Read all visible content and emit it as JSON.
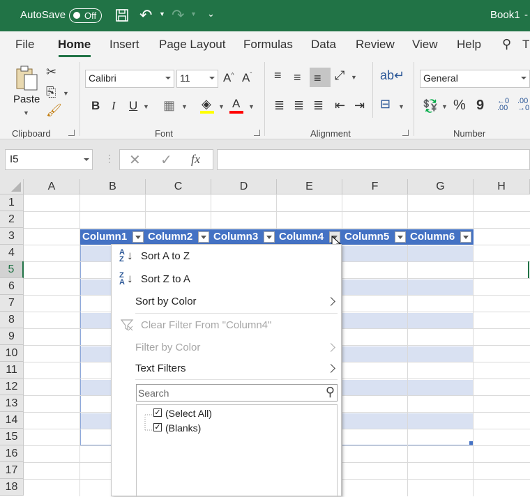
{
  "title_bar": {
    "autosave_label": "AutoSave",
    "autosave_state": "Off",
    "file_name": "Book1",
    "more": "-"
  },
  "ribbon_tabs": [
    "File",
    "Home",
    "Insert",
    "Page Layout",
    "Formulas",
    "Data",
    "Review",
    "View",
    "Help",
    "T"
  ],
  "ribbon": {
    "clipboard": {
      "paste_label": "Paste",
      "group_label": "Clipboard"
    },
    "font": {
      "font_name": "Calibri",
      "font_size": "11",
      "group_label": "Font",
      "bold": "B",
      "italic": "I",
      "underline": "U"
    },
    "alignment": {
      "group_label": "Alignment"
    },
    "number": {
      "format": "General",
      "group_label": "Number",
      "percent": "%",
      "comma": "9"
    }
  },
  "formula_bar": {
    "name_box": "I5",
    "fx": "fx",
    "formula": ""
  },
  "columns": [
    "A",
    "B",
    "C",
    "D",
    "E",
    "F",
    "G",
    "H"
  ],
  "rows": [
    "1",
    "2",
    "3",
    "4",
    "5",
    "6",
    "7",
    "8",
    "9",
    "10",
    "11",
    "12",
    "13",
    "14",
    "15",
    "16",
    "17",
    "18"
  ],
  "selected_row": "5",
  "table_headers": [
    "Column1",
    "Column2",
    "Column3",
    "Column4",
    "Column5",
    "Column6"
  ],
  "filter_menu": {
    "sort_az": "Sort A to Z",
    "sort_za": "Sort Z to A",
    "sort_by_color": "Sort by Color",
    "clear_filter": "Clear Filter From \"Column4\"",
    "filter_by_color": "Filter by Color",
    "text_filters": "Text Filters",
    "search_placeholder": "Search",
    "items": [
      {
        "label": "(Select All)",
        "checked": true
      },
      {
        "label": "(Blanks)",
        "checked": true
      }
    ]
  },
  "colors": {
    "excel_green": "#217346",
    "table_header": "#4472c4",
    "band": "#d9e1f2"
  }
}
